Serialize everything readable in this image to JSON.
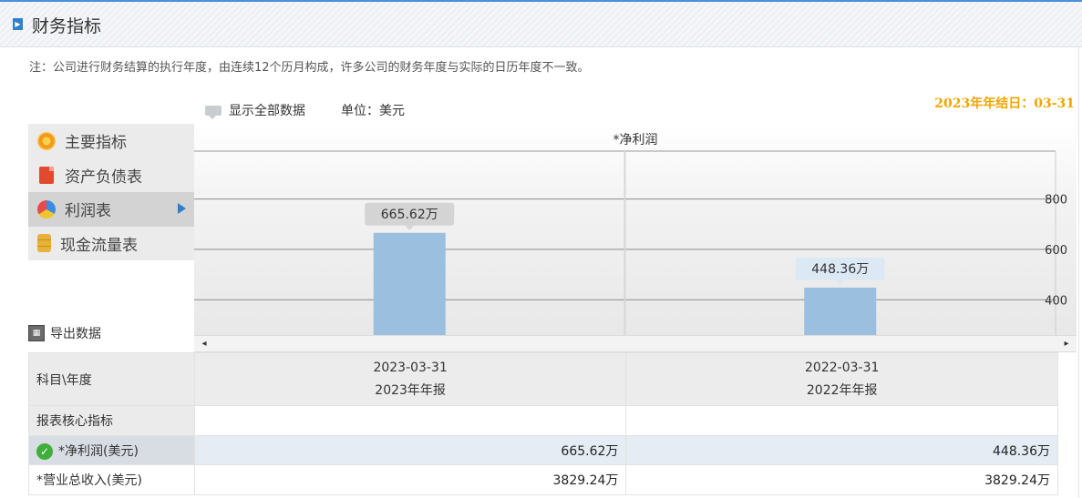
{
  "header": {
    "title": "财务指标",
    "icon": "arrow-right-icon"
  },
  "note": "注：公司进行财务结算的执行年度，由连续12个历月构成，许多公司的财务年度与实际的日历年度不一致。",
  "fiscal_year_end": "2023年年结日：03-31",
  "toolbar": {
    "show_all_label": "显示全部数据",
    "unit_label": "单位：美元"
  },
  "sidebar": {
    "items": [
      {
        "label": "主要指标",
        "icon": "flower-icon"
      },
      {
        "label": "资产负债表",
        "icon": "document-icon"
      },
      {
        "label": "利润表",
        "icon": "pie-chart-icon",
        "active": true
      },
      {
        "label": "现金流量表",
        "icon": "coins-icon"
      }
    ]
  },
  "export_label": "导出数据",
  "chart_data": {
    "type": "bar",
    "title": "*净利润",
    "categories": [
      "2023-03-31",
      "2022-03-31"
    ],
    "values": [
      665.62,
      448.36
    ],
    "data_labels": [
      "665.62万",
      "448.36万"
    ],
    "yticks": [
      400,
      600,
      800
    ],
    "ylim": [
      260,
      990
    ],
    "bar_color": "#9bbfde",
    "grid": true
  },
  "table": {
    "header": {
      "col0": "科目\\年度",
      "cols": [
        {
          "date": "2023-03-31",
          "report": "2023年年报"
        },
        {
          "date": "2022-03-31",
          "report": "2022年年报"
        }
      ]
    },
    "section_label": "报表核心指标",
    "rows": [
      {
        "label": "*净利润(美元)",
        "values": [
          "665.62万",
          "448.36万"
        ],
        "checked": true
      },
      {
        "label": "*营业总收入(美元)",
        "values": [
          "3829.24万",
          "3829.24万"
        ]
      }
    ]
  },
  "scrollbar": {
    "left_arrow": "◂",
    "right_arrow": "▸"
  }
}
